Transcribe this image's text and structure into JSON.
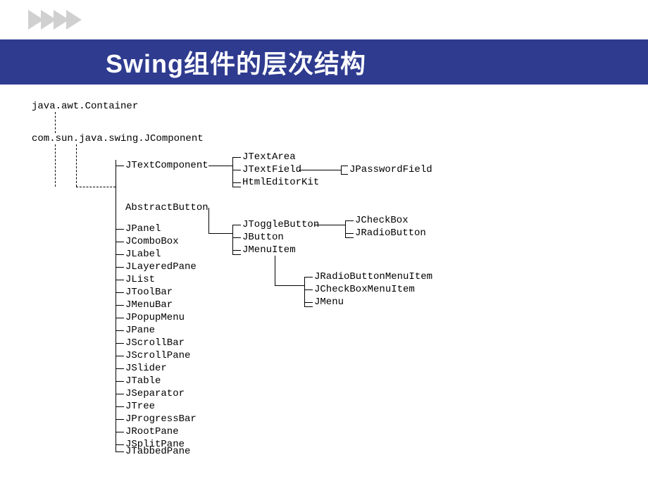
{
  "title": "Swing组件的层次结构",
  "root": "java.awt.Container",
  "level1": "com.sun.java.swing.JComponent",
  "jcomponent_children": {
    "textcomponent": "JTextComponent",
    "abstractbutton": "AbstractButton",
    "list": [
      "JPanel",
      "JComboBox",
      "JLabel",
      "JLayeredPane",
      "JList",
      "JToolBar",
      "JMenuBar",
      "JPopupMenu",
      "JPane",
      "JScrollBar",
      "JScrollPane",
      "JSlider",
      "JTable",
      "JSeparator",
      "JTree",
      "JProgressBar",
      "JRootPane",
      "JSplitPane",
      "JTabbedPane"
    ]
  },
  "textcomponent_children": [
    "JTextArea",
    "JTextField",
    "HtmlEditorKit"
  ],
  "textfield_child": "JPasswordField",
  "abstractbutton_children": [
    "JToggleButton",
    "JButton",
    "JMenuItem"
  ],
  "togglebutton_children": [
    "JCheckBox",
    "JRadioButton"
  ],
  "menuitem_children": [
    "JRadioButtonMenuItem",
    "JCheckBoxMenuItem",
    "JMenu"
  ]
}
